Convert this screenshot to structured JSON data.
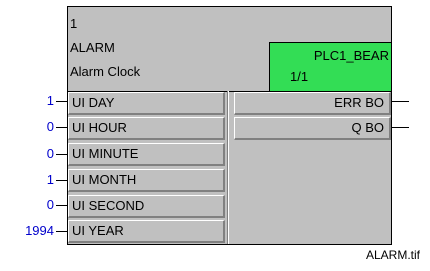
{
  "block": {
    "instance": "1",
    "type_name": "ALARM",
    "description": "Alarm Clock",
    "plc": {
      "name": "PLC1_BEAR",
      "slot": "1/1",
      "color": "#33dd55"
    }
  },
  "inputs": [
    {
      "label": "UI DAY",
      "value": "1"
    },
    {
      "label": "UI HOUR",
      "value": "0"
    },
    {
      "label": "UI MINUTE",
      "value": "0"
    },
    {
      "label": "UI MONTH",
      "value": "1"
    },
    {
      "label": "UI SECOND",
      "value": "0"
    },
    {
      "label": "UI YEAR",
      "value": "1994"
    }
  ],
  "outputs": [
    {
      "label": "ERR BO"
    },
    {
      "label": "Q BO"
    }
  ],
  "colors": {
    "value_text": "#0000cc",
    "block_bg": "#c0c0c0"
  },
  "caption": "ALARM.tif"
}
